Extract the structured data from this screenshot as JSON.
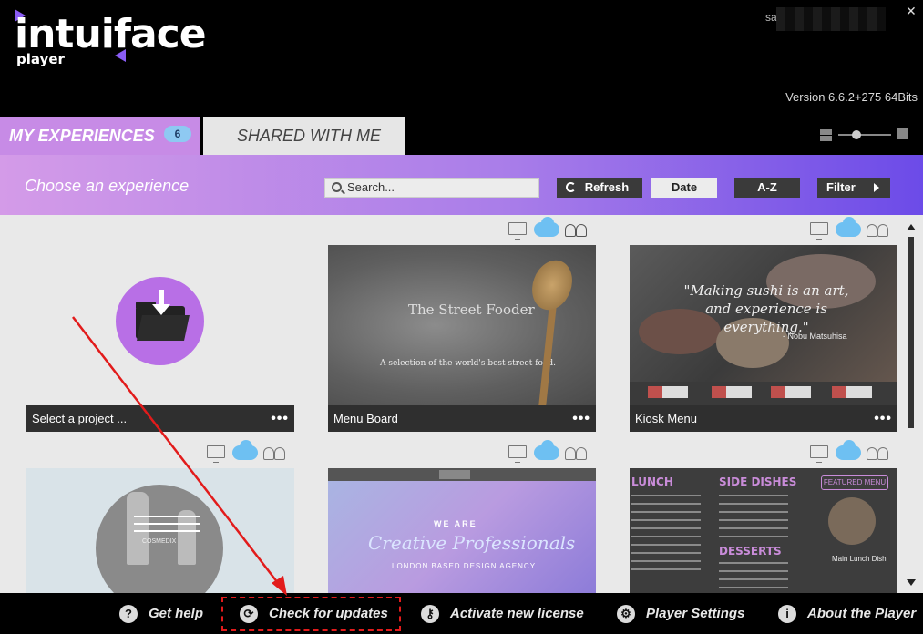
{
  "app": {
    "logo_word": "intuiface",
    "logo_sub": "player",
    "user_name": "sa",
    "version": "Version 6.6.2+275 64Bits",
    "brand_purple": "#8a5cf5"
  },
  "tabs": {
    "my_experiences": "MY EXPERIENCES",
    "my_experiences_count": "6",
    "shared_with_me": "SHARED WITH ME"
  },
  "toolbar": {
    "title": "Choose an experience",
    "search_placeholder": "Search...",
    "refresh_label": "Refresh",
    "date_label": "Date",
    "az_label": "A-Z",
    "filter_label": "Filter"
  },
  "cards": [
    {
      "caption": "Select a project ...",
      "dots": "•••",
      "icon": "folder-download-icon"
    },
    {
      "caption": "Menu Board",
      "dots": "•••",
      "thumb_title": "The Street Fooder",
      "thumb_sub": "A selection of the world's best street food."
    },
    {
      "caption": "Kiosk Menu",
      "dots": "•••",
      "thumb_quote": "\"Making sushi is an art, and experience is everything.\"",
      "thumb_author": "- Nobu Matsuhisa"
    },
    {
      "caption": "",
      "thumb_label": "COSMEDIX"
    },
    {
      "caption": "",
      "thumb_weare": "WE ARE",
      "thumb_title": "Creative Professionals",
      "thumb_sub": "LONDON BASED DESIGN AGENCY"
    },
    {
      "caption": "",
      "thumb_h1": "LUNCH",
      "thumb_h2": "SIDE DISHES",
      "thumb_h3": "DESSERTS",
      "thumb_badge": "FEATURED MENU",
      "thumb_item": "Main Lunch Dish"
    }
  ],
  "footer": {
    "help": "Get help",
    "updates": "Check for updates",
    "license": "Activate new license",
    "settings": "Player Settings",
    "about": "About the Player",
    "help_glyph": "?",
    "about_glyph": "i"
  },
  "colors": {
    "band_start": "#d49be8",
    "band_end": "#6c4be8",
    "annotation_red": "#e21b1b",
    "cloud_blue": "#6ec0f2"
  }
}
